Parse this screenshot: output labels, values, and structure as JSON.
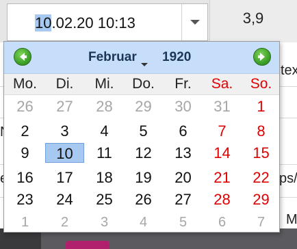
{
  "date_field": {
    "value_selected": "10",
    "value_rest": ".02.20 10:13"
  },
  "background": {
    "cell_value": "3,9",
    "fragment_right_1": "tex",
    "fragment_right_2": "ps/",
    "fragment_right_3": "M",
    "fragment_left_1": "N",
    "fragment_left_2": "e"
  },
  "calendar": {
    "month": "Februar",
    "year": "1920",
    "weekdays": [
      "Mo.",
      "Di.",
      "Mi.",
      "Do.",
      "Fr.",
      "Sa.",
      "So."
    ],
    "weeks": [
      [
        "26",
        "27",
        "28",
        "29",
        "30",
        "31",
        "1"
      ],
      [
        "2",
        "3",
        "4",
        "5",
        "6",
        "7",
        "8"
      ],
      [
        "9",
        "10",
        "11",
        "12",
        "13",
        "14",
        "15"
      ],
      [
        "16",
        "17",
        "18",
        "19",
        "20",
        "21",
        "22"
      ],
      [
        "23",
        "24",
        "25",
        "26",
        "27",
        "28",
        "29"
      ],
      [
        "1",
        "2",
        "3",
        "4",
        "5",
        "6",
        "7"
      ]
    ],
    "selected_day": "10",
    "colors": {
      "header": "#c6defa",
      "weekend": "#e00000",
      "other_month": "#a6a6a6",
      "selection": "#a7c8f0"
    },
    "icons": {
      "prev": "arrow-left-green-icon",
      "next": "arrow-right-green-icon"
    }
  }
}
